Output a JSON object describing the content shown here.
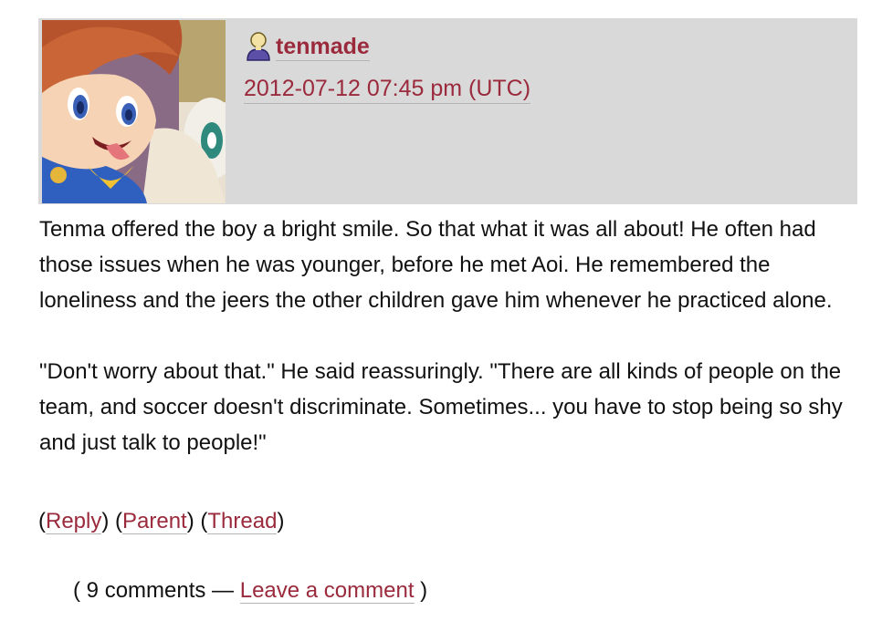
{
  "entry": {
    "username": "tenmade",
    "user_icon": "user-icon",
    "timestamp": "2012-07-12 07:45 pm (UTC)",
    "paragraphs": [
      "Tenma offered the boy a bright smile. So that what it was all about! He often had those issues when he was younger, before he met Aoi. He remembered the loneliness and the jeers the other children gave him whenever he practiced alone.",
      "\"Don't worry about that.\" He said reassuringly. \"There are all kinds of people on the team, and soccer doesn't discriminate. Sometimes... you have to stop being so shy and just talk to people!\""
    ],
    "actions": {
      "reply": "Reply",
      "parent": "Parent",
      "thread": "Thread"
    }
  },
  "footer": {
    "comment_count": "9 comments",
    "leave_comment": "Leave a comment"
  },
  "colors": {
    "link": "#9a2a3c",
    "header_bg": "#d9d9d9"
  }
}
